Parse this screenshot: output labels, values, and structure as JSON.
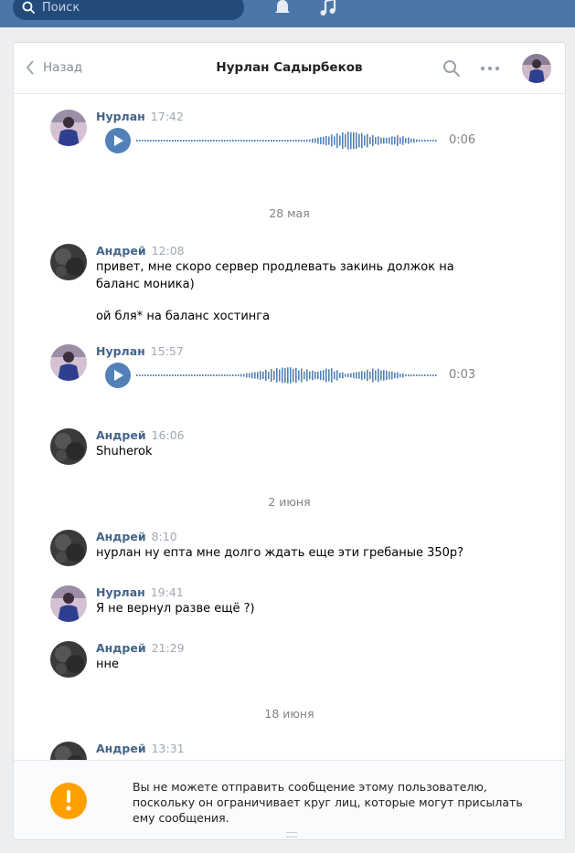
{
  "topbar": {
    "search_placeholder": "Поиск",
    "icons": [
      "search-icon",
      "bell-icon",
      "music-icon"
    ],
    "bg_color": "#4a76a8"
  },
  "header": {
    "back_label": "Назад",
    "title": "Нурлан Садырбеков",
    "icons": [
      "search-icon",
      "more-icon",
      "avatar"
    ]
  },
  "messages": [
    {
      "author": "Нурлан",
      "time": "17:42",
      "voice_duration": "0:06"
    },
    {
      "date": "28 мая"
    },
    {
      "author": "Андрей",
      "time": "12:08",
      "lines": [
        "привет, мне скоро сервер продлевать закинь должок на баланс моника)",
        "ой бля* на баланс хостинга"
      ]
    },
    {
      "author": "Нурлан",
      "time": "15:57",
      "voice_duration": "0:03"
    },
    {
      "author": "Андрей",
      "time": "16:06",
      "text": "Shuherok"
    },
    {
      "date": "2 июня"
    },
    {
      "author": "Андрей",
      "time": "8:10",
      "text": "нурлан ну епта мне долго ждать еще эти гребаные 350р?"
    },
    {
      "author": "Нурлан",
      "time": "19:41",
      "text": "Я не вернул разве ещё ?)"
    },
    {
      "author": "Андрей",
      "time": "21:29",
      "text": "нне"
    },
    {
      "date": "18 июня"
    },
    {
      "author": "Андрей",
      "time": "13:31"
    }
  ],
  "footer": {
    "warning": "Вы не можете отправить сообщение этому пользователю, поскольку он ограничивает круг лиц, которые могут присылать ему сообщения.",
    "warning_color": "#ffa000"
  },
  "accent_color": "#5181b8"
}
